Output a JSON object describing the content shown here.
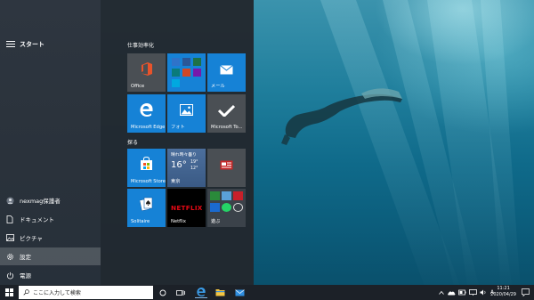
{
  "start_menu": {
    "title": "スタート",
    "rail_items": [
      {
        "label": "nexmag保護者",
        "icon": "user-icon"
      },
      {
        "label": "ドキュメント",
        "icon": "document-icon"
      },
      {
        "label": "ピクチャ",
        "icon": "pictures-icon"
      },
      {
        "label": "設定",
        "icon": "gear-icon"
      },
      {
        "label": "電源",
        "icon": "power-icon"
      }
    ],
    "groups": [
      {
        "label": "仕事効率化"
      },
      {
        "label": "探る"
      }
    ],
    "tiles": {
      "office": "Office",
      "mail": "メール",
      "edge": "Microsoft Edge",
      "photos": "フォト",
      "todo": "Microsoft To...",
      "store": "Microsoft Store",
      "weather_desc": "晴れ時々曇り",
      "weather_temp": "16°",
      "weather_hi": "19°",
      "weather_lo": "12°",
      "weather_city": "東京",
      "solitaire": "Solitaire",
      "netflix_logo": "NETFLIX",
      "netflix": "Netflix",
      "play": "遊ぶ"
    }
  },
  "taskbar": {
    "search_placeholder": "ここに入力して検索",
    "ime": "A",
    "time": "11:21",
    "date": "2020/04/29"
  },
  "colors": {
    "accent": "#1682d6",
    "taskbar": "#1c2128",
    "office_tile": "#4a4f54"
  }
}
